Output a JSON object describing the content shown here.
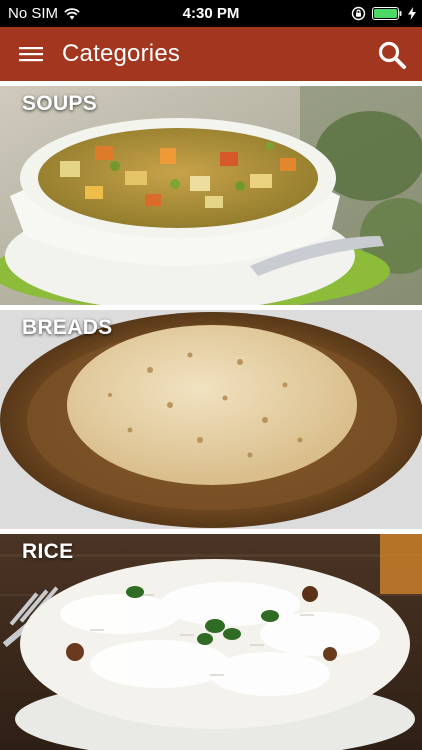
{
  "status_bar": {
    "carrier": "No SIM",
    "time": "4:30 PM"
  },
  "app_bar": {
    "title": "Categories",
    "menu_icon": "hamburger-menu-icon",
    "search_icon": "search-icon"
  },
  "colors": {
    "app_bar": "#a2361f",
    "status_bar": "#000000",
    "battery": "#4cd964"
  },
  "categories": [
    {
      "label": "SOUPS",
      "image": "vegetable-soup-bowl-photo"
    },
    {
      "label": "BREADS",
      "image": "roti-on-plate-photo"
    },
    {
      "label": "RICE",
      "image": "rice-bowl-photo"
    }
  ]
}
